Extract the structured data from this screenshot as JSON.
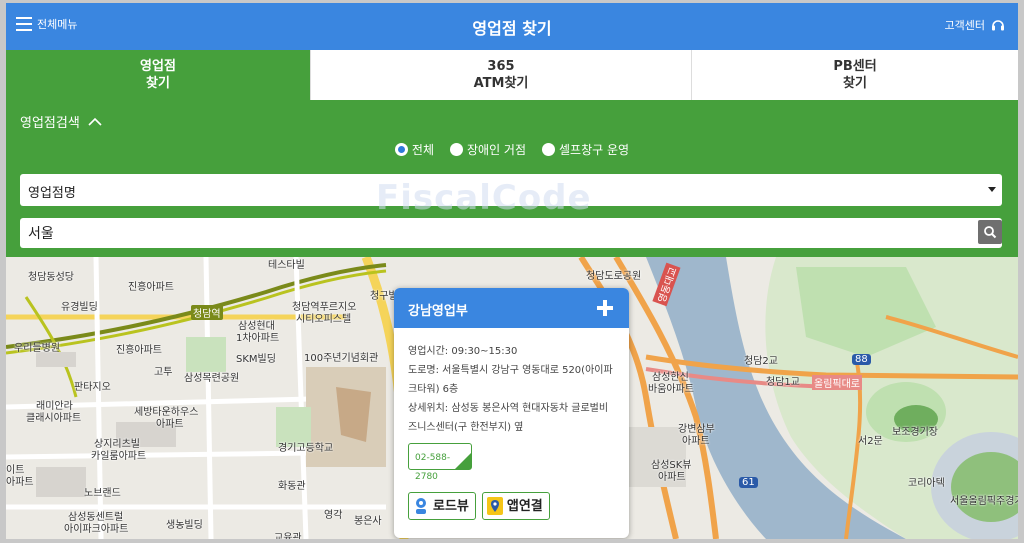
{
  "header": {
    "menu_label": "전체메뉴",
    "title": "영업점 찾기",
    "cs_label": "고객센터"
  },
  "tabs": [
    {
      "line1": "영업점",
      "line2": "찾기",
      "active": true
    },
    {
      "line1": "365",
      "line2": "ATM찾기",
      "active": false
    },
    {
      "line1": "PB센터",
      "line2": "찾기",
      "active": false
    }
  ],
  "search": {
    "toggle_label": "영업점검색",
    "radios": [
      {
        "label": "전체",
        "checked": true
      },
      {
        "label": "장애인 거점",
        "checked": false
      },
      {
        "label": "셀프창구 운영",
        "checked": false
      }
    ],
    "select_value": "영업점명",
    "region_value": "서울",
    "watermark": "FiscalCode"
  },
  "map": {
    "labels": {
      "l1": "청담동성당",
      "l2": "진흥아파트",
      "l3": "유경빌딩",
      "l4": "청담역",
      "l5": "우리들병원",
      "l6": "진흥아파트",
      "l7": "판타지오",
      "l8": "래미안라",
      "l9": "클래시아파트",
      "l10": "세방타운하우스",
      "l11": "아파트",
      "l12": "상지리츠빌",
      "l13": "카일룸아파트",
      "l14": "노브랜드",
      "l15": "삼성동센트럴",
      "l16": "아이파크아파트",
      "l17": "생농빌딩",
      "l18": "삼성현대",
      "l19": "1차아파트",
      "l20": "SKM빌딩",
      "l21": "삼성목련공원",
      "l22": "고투",
      "l23": "100주년기념회관",
      "l24": "경기고등학교",
      "l25": "화동관",
      "l26": "청담역푸르지오",
      "l27": "시티오피스텔",
      "l28": "테스타빌",
      "l29": "청구빌",
      "l30": "영각",
      "l31": "봉은사",
      "l32": "교육관",
      "l33": "청담도로공원",
      "l34": "청담2교",
      "l35": "청담1교",
      "l36": "올림픽대로",
      "l37": "삼성한신",
      "l38": "바움아파트",
      "l39": "강변삼부",
      "l40": "아파트",
      "l41": "삼성SK뷰",
      "l42": "아파트",
      "l43": "서2문",
      "l44": "보조경기장",
      "l45": "코리아텍",
      "l46": "서울올림픽주경기",
      "l47": "영동대교",
      "l48": "88",
      "l49": "61",
      "l50": "이트",
      "l51": "아파트"
    }
  },
  "popup": {
    "title": "강남영업부",
    "hours": "영업시간: 09:30~15:30",
    "road_addr": "도로명: 서울특별시 강남구 영동대로 520(아이파크타워) 6층",
    "detail": "상세위치: 삼성동 봉은사역 현대자동차 글로벌비즈니스센터(구 한전부지) 옆",
    "phone": "02-588-2780",
    "roadview_label": "로드뷰",
    "app_label": "앱연결"
  },
  "colors": {
    "header_blue": "#3a86e0",
    "tab_green": "#46a03c",
    "map_river": "#9fb7cc",
    "map_park": "#bfe0b0",
    "road_orange": "#f0a34a"
  }
}
